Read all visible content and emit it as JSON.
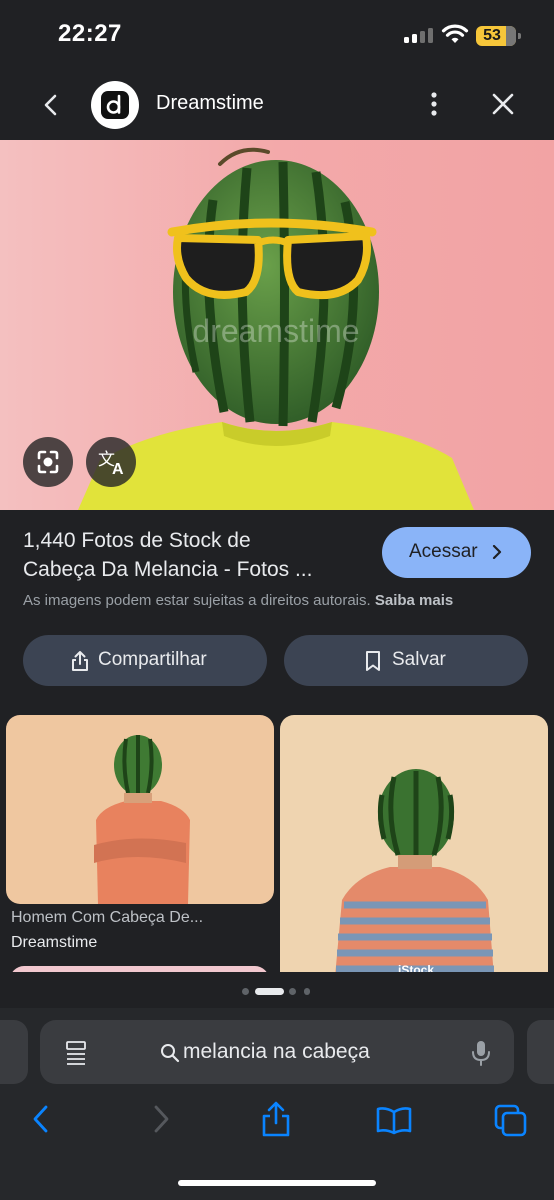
{
  "status_bar": {
    "time": "22:27",
    "battery": "53"
  },
  "header": {
    "site_name": "Dreamstime",
    "logo_letter": "d",
    "icons": [
      "back-chevron-icon",
      "more-vertical-icon",
      "close-icon"
    ]
  },
  "hero": {
    "watermark": "dreamstime",
    "buttons": [
      "lens-icon",
      "translate-icon"
    ]
  },
  "result": {
    "title_line1": "1,440 Fotos de Stock de",
    "title_line2": "Cabeça Da Melancia - Fotos ...",
    "visit_label": "Acessar",
    "copyright_text": "As imagens podem estar sujeitas a direitos autorais.",
    "learn_more": "Saiba mais",
    "share_label": "Compartilhar",
    "save_label": "Salvar"
  },
  "related": [
    {
      "caption": "Homem Com Cabeça De...",
      "source": "Dreamstime"
    },
    {
      "caption": "",
      "source": "",
      "watermark": "iStock"
    }
  ],
  "browser": {
    "address_text": "melancia na cabeça",
    "accent_color": "#0a84ff",
    "icons": [
      "reader-icon",
      "search-icon",
      "mic-icon",
      "back-arrow-icon",
      "forward-arrow-icon",
      "share-icon",
      "bookmarks-icon",
      "tabs-icon"
    ]
  },
  "colors": {
    "background": "#202124",
    "visit_button": "#8ab4f8",
    "pill_button": "#3c4453"
  }
}
